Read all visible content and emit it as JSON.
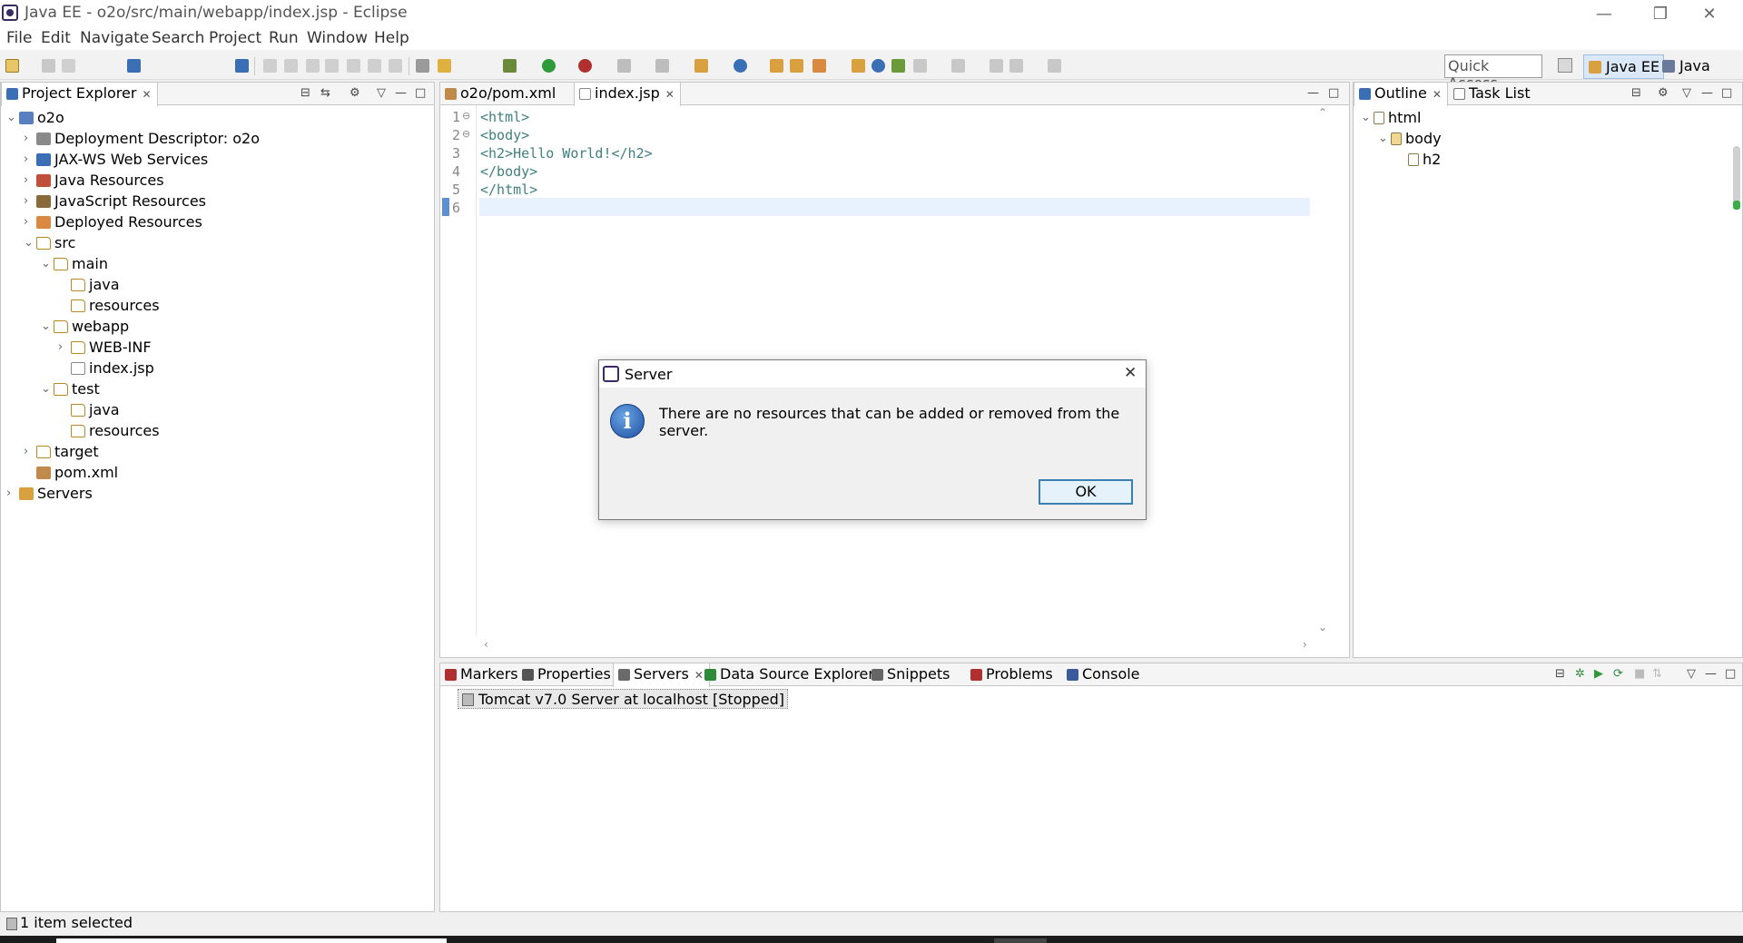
{
  "window": {
    "title": "Java EE - o2o/src/main/webapp/index.jsp - Eclipse",
    "minimize": "—",
    "restore": "❐",
    "close": "✕"
  },
  "menu": [
    "File",
    "Edit",
    "Navigate",
    "Search",
    "Project",
    "Run",
    "Window",
    "Help"
  ],
  "toolbar": {
    "quick_access_placeholder": "Quick Access"
  },
  "perspectives": {
    "java_ee": "Java EE",
    "java": "Java"
  },
  "project_explorer": {
    "tab_label": "Project Explorer",
    "tree": [
      {
        "label": "o2o",
        "twisty": "⌄",
        "icon": "project-icon"
      },
      {
        "label": "Deployment Descriptor: o2o",
        "twisty": "›",
        "icon": "deployment-descriptor-icon"
      },
      {
        "label": "JAX-WS Web Services",
        "twisty": "›",
        "icon": "web-services-icon"
      },
      {
        "label": "Java Resources",
        "twisty": "›",
        "icon": "java-resources-icon"
      },
      {
        "label": "JavaScript Resources",
        "twisty": "›",
        "icon": "javascript-resources-icon"
      },
      {
        "label": "Deployed Resources",
        "twisty": "›",
        "icon": "deployed-resources-icon"
      },
      {
        "label": "src",
        "twisty": "⌄",
        "icon": "folder-icon"
      },
      {
        "label": "main",
        "twisty": "⌄",
        "icon": "folder-icon"
      },
      {
        "label": "java",
        "twisty": "",
        "icon": "folder-icon"
      },
      {
        "label": "resources",
        "twisty": "",
        "icon": "folder-icon"
      },
      {
        "label": "webapp",
        "twisty": "⌄",
        "icon": "folder-icon"
      },
      {
        "label": "WEB-INF",
        "twisty": "›",
        "icon": "folder-icon"
      },
      {
        "label": "index.jsp",
        "twisty": "",
        "icon": "jsp-file-icon"
      },
      {
        "label": "test",
        "twisty": "⌄",
        "icon": "folder-icon"
      },
      {
        "label": "java",
        "twisty": "",
        "icon": "folder-icon"
      },
      {
        "label": "resources",
        "twisty": "",
        "icon": "folder-icon"
      },
      {
        "label": "target",
        "twisty": "›",
        "icon": "folder-icon"
      },
      {
        "label": "pom.xml",
        "twisty": "",
        "icon": "xml-file-icon"
      },
      {
        "label": "Servers",
        "twisty": "›",
        "icon": "servers-folder-icon"
      }
    ]
  },
  "editor": {
    "tabs": [
      {
        "label": "o2o/pom.xml"
      },
      {
        "label": "index.jsp"
      }
    ],
    "lines": [
      {
        "num": "1",
        "fold": "⊖",
        "text": "<html>",
        "tagged": true
      },
      {
        "num": "2",
        "fold": "⊖",
        "text": "<body>",
        "tagged": true
      },
      {
        "num": "3",
        "fold": "",
        "text": "<h2>Hello World!</h2>",
        "tagged": true
      },
      {
        "num": "4",
        "fold": "",
        "text": "</body>",
        "tagged": true
      },
      {
        "num": "5",
        "fold": "",
        "text": "</html>",
        "tagged": true
      },
      {
        "num": "6",
        "fold": "",
        "text": "",
        "tagged": false
      }
    ]
  },
  "outline": {
    "tabs": [
      {
        "label": "Outline"
      },
      {
        "label": "Task List"
      }
    ],
    "tree": [
      {
        "label": "html",
        "twisty": "⌄"
      },
      {
        "label": "body",
        "twisty": "⌄"
      },
      {
        "label": "h2",
        "twisty": ""
      }
    ]
  },
  "bottom": {
    "tabs": [
      "Markers",
      "Properties",
      "Servers",
      "Data Source Explorer",
      "Snippets",
      "Problems",
      "Console"
    ],
    "server_entry": "Tomcat v7.0 Server at localhost  [Stopped]"
  },
  "dialog": {
    "title": "Server",
    "message": "There are no resources that can be added or removed from the server.",
    "ok_label": "OK",
    "close": "✕"
  },
  "status": {
    "text": "1 item selected"
  }
}
